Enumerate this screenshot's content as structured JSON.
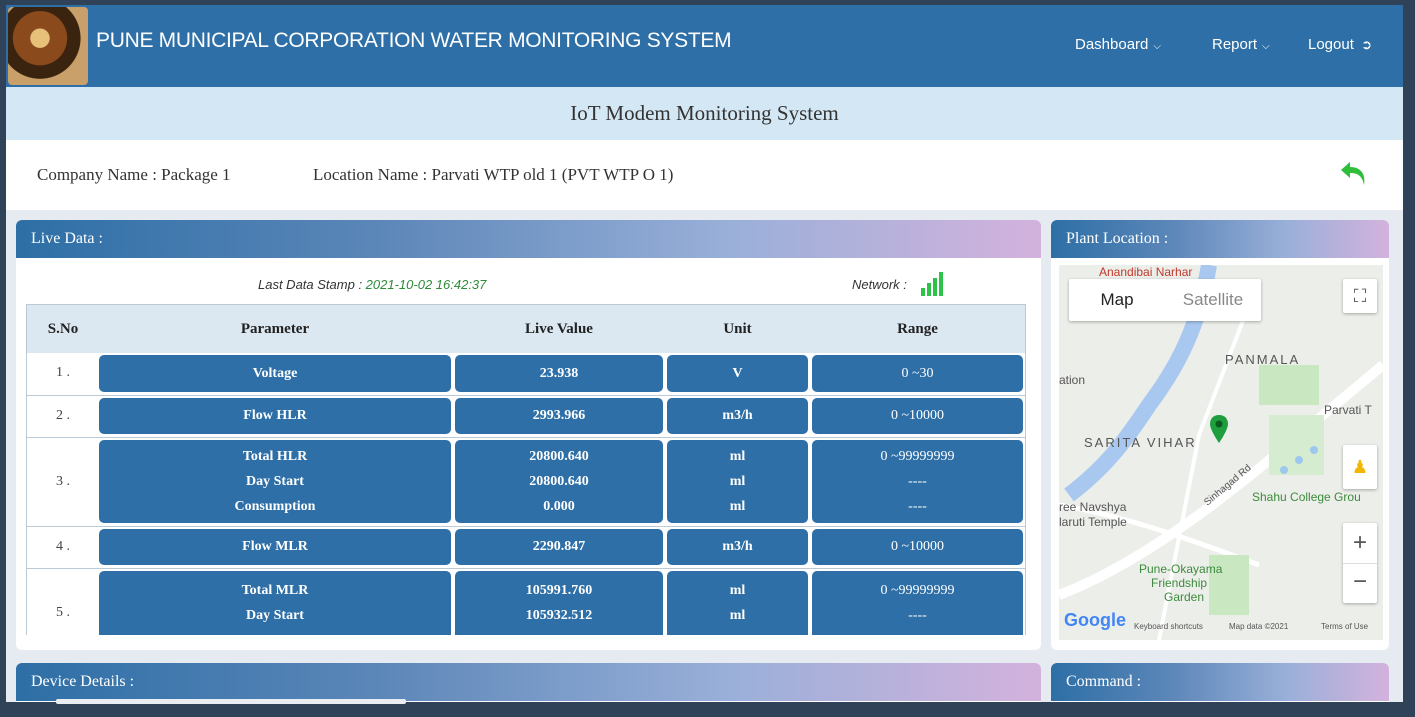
{
  "header": {
    "title": "PUNE MUNICIPAL CORPORATION WATER MONITORING SYSTEM",
    "nav": {
      "dashboard": "Dashboard",
      "report": "Report",
      "logout": "Logout"
    }
  },
  "page_title": "IoT Modem Monitoring System",
  "info": {
    "company": "Company Name : Package 1",
    "location": "Location Name : Parvati WTP old 1 (PVT WTP O 1)"
  },
  "live": {
    "title": "Live Data :",
    "stamp_label": "Last Data Stamp : ",
    "stamp_value": "2021-10-02 16:42:37",
    "network_label": "Network : ",
    "columns": [
      "S.No",
      "Parameter",
      "Live Value",
      "Unit",
      "Range"
    ],
    "rows": [
      {
        "sno": "1 .",
        "params": [
          "Voltage"
        ],
        "values": [
          "23.938"
        ],
        "units": [
          "V"
        ],
        "ranges": [
          "0 ~30"
        ]
      },
      {
        "sno": "2 .",
        "params": [
          "Flow HLR"
        ],
        "values": [
          "2993.966"
        ],
        "units": [
          "m3/h"
        ],
        "ranges": [
          "0 ~10000"
        ]
      },
      {
        "sno": "3 .",
        "params": [
          "Total HLR",
          "Day Start",
          "Consumption"
        ],
        "values": [
          "20800.640",
          "20800.640",
          "0.000"
        ],
        "units": [
          "ml",
          "ml",
          "ml"
        ],
        "ranges": [
          "0 ~99999999",
          "----",
          "----"
        ]
      },
      {
        "sno": "4 .",
        "params": [
          "Flow MLR"
        ],
        "values": [
          "2290.847"
        ],
        "units": [
          "m3/h"
        ],
        "ranges": [
          "0 ~10000"
        ]
      },
      {
        "sno": "5 .",
        "params": [
          "Total MLR",
          "Day Start"
        ],
        "values": [
          "105991.760",
          "105932.512"
        ],
        "units": [
          "ml",
          "ml"
        ],
        "ranges": [
          "0 ~99999999",
          "----"
        ]
      }
    ]
  },
  "map": {
    "title": "Plant Location :",
    "toggle_map": "Map",
    "toggle_satellite": "Satellite",
    "labels": {
      "top": "Anandibai Narhar",
      "panmala": "PANMALA",
      "sarita": "SARITA VIHAR",
      "parvati": "Parvati T",
      "shahu": "Shahu College Grou",
      "navshya": "ree Navshya",
      "temple": "laruti Temple",
      "okayama": "Pune-Okayama",
      "friendship": "Friendship",
      "garden": "Garden",
      "ation": "ation",
      "road": "Sinhagad Rd"
    },
    "footer": {
      "keyboard": "Keyboard shortcuts",
      "mapdata": "Map data ©2021",
      "terms": "Terms of Use"
    }
  },
  "device": {
    "title": "Device Details :"
  },
  "command": {
    "title": "Command :"
  }
}
